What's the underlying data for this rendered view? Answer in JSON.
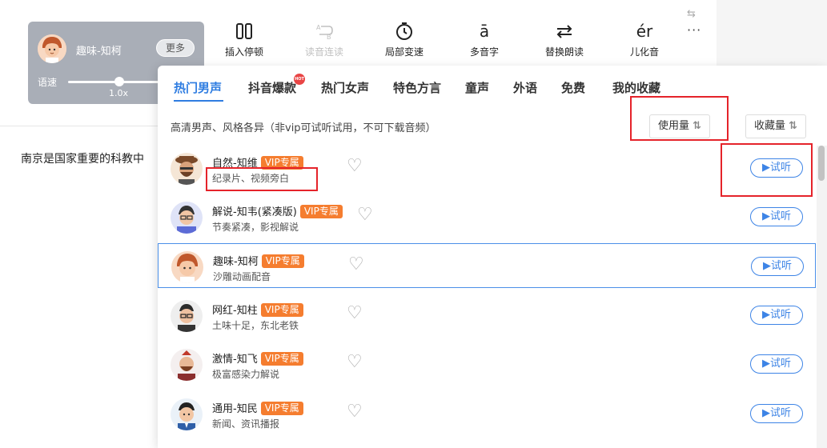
{
  "voice_card": {
    "name": "趣味-知柯",
    "more_label": "更多",
    "speed_label": "语速",
    "speed_value": "1.0x",
    "speed_fraction": 0.35
  },
  "toolbar": {
    "items": [
      {
        "label": "插入停顿",
        "icon": "pause-icon",
        "enabled": true
      },
      {
        "label": "读音连读",
        "icon": "link-reading-icon",
        "enabled": false
      },
      {
        "label": "局部变速",
        "icon": "timer-icon",
        "enabled": true
      },
      {
        "label": "多音字",
        "icon": "polyphone-icon",
        "enabled": true
      },
      {
        "label": "替换朗读",
        "icon": "swap-icon",
        "enabled": true
      },
      {
        "label": "儿化音",
        "icon": "er-icon",
        "enabled": true
      }
    ],
    "er_glyph": "ér",
    "polyphone_glyph": "ā"
  },
  "document": {
    "text": "南京是国家重要的科教中"
  },
  "dropdown": {
    "tabs": [
      "热门男声",
      "抖音爆款",
      "热门女声",
      "特色方言",
      "童声",
      "外语",
      "免费",
      "我的收藏"
    ],
    "active_tab": 0,
    "hot_badge": "HOT",
    "description": "高清男声、风格各异（非vip可试听试用，不可下载音频）",
    "sort_usage": "使用量",
    "sort_favorites": "收藏量",
    "sort_icon": "⇅",
    "try_label": "▶试听",
    "vip_label": "VIP专属",
    "voices": [
      {
        "name": "自然-知维",
        "vip": true,
        "desc": "纪录片、视频旁白",
        "selected": false
      },
      {
        "name": "解说-知韦(紧凑版)",
        "vip": true,
        "desc": "节奏紧凑，影视解说",
        "selected": false
      },
      {
        "name": "趣味-知柯",
        "vip": true,
        "desc": "沙雕动画配音",
        "selected": true
      },
      {
        "name": "网红-知柱",
        "vip": true,
        "desc": "土味十足，东北老铁",
        "selected": false
      },
      {
        "name": "激情-知飞",
        "vip": true,
        "desc": "极富感染力解说",
        "selected": false
      },
      {
        "name": "通用-知民",
        "vip": true,
        "desc": "新闻、资讯播报",
        "selected": false
      }
    ]
  },
  "colors": {
    "accent": "#2f7de1",
    "vip": "#f57d2f",
    "highlight_box": "#e5232a"
  }
}
